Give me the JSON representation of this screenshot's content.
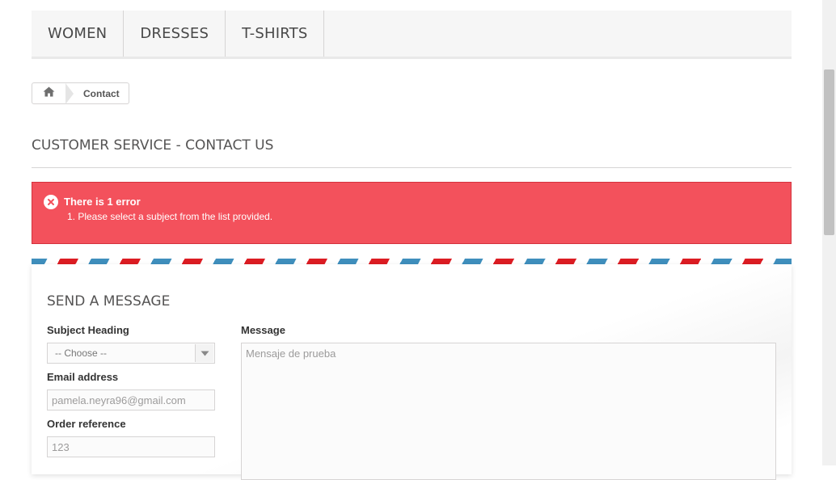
{
  "topnav": {
    "items": [
      {
        "label": "WOMEN"
      },
      {
        "label": "DRESSES"
      },
      {
        "label": "T-SHIRTS"
      }
    ]
  },
  "breadcrumb": {
    "home_icon": "home-icon",
    "current": "Contact"
  },
  "page": {
    "heading": "CUSTOMER SERVICE - CONTACT US"
  },
  "alert": {
    "icon": "close-circle-icon",
    "title": "There is 1 error",
    "item": "1. Please select a subject from the list provided.",
    "color": "#f3515c"
  },
  "form": {
    "title": "SEND A MESSAGE",
    "subject_label": "Subject Heading",
    "subject_value": "-- Choose --",
    "email_label": "Email address",
    "email_value": "pamela.neyra96@gmail.com",
    "order_label": "Order reference",
    "order_value": "123",
    "message_label": "Message",
    "message_value": "Mensaje de prueba"
  },
  "colors": {
    "stripe_blue": "#3f8fbd",
    "stripe_red": "#dc1c23"
  }
}
